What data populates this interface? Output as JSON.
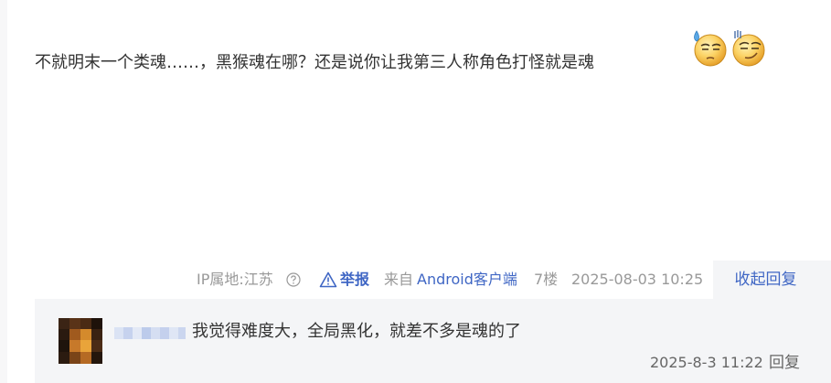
{
  "post": {
    "content": "不就明末一个类魂……，黑猴魂在哪？还是说你让我第三人称角色打怪就是魂",
    "emojis": [
      "sweat-squint-emoji",
      "smirk-squint-emoji"
    ]
  },
  "meta": {
    "ip_location": "IP属地:江苏",
    "report_label": "举报",
    "from_prefix": "来自",
    "client": "Android客户端",
    "floor": "7楼",
    "timestamp": "2025-08-03 10:25"
  },
  "collapse_reply_label": "收起回复",
  "reply": {
    "text": "我觉得难度大，全局黑化，就差不多是魂的了",
    "timestamp": "2025-8-3 11:22",
    "reply_label": "回复"
  },
  "colors": {
    "link": "#3f66c4",
    "meta_gray": "#999999",
    "reply_bg": "#f4f5f7"
  }
}
